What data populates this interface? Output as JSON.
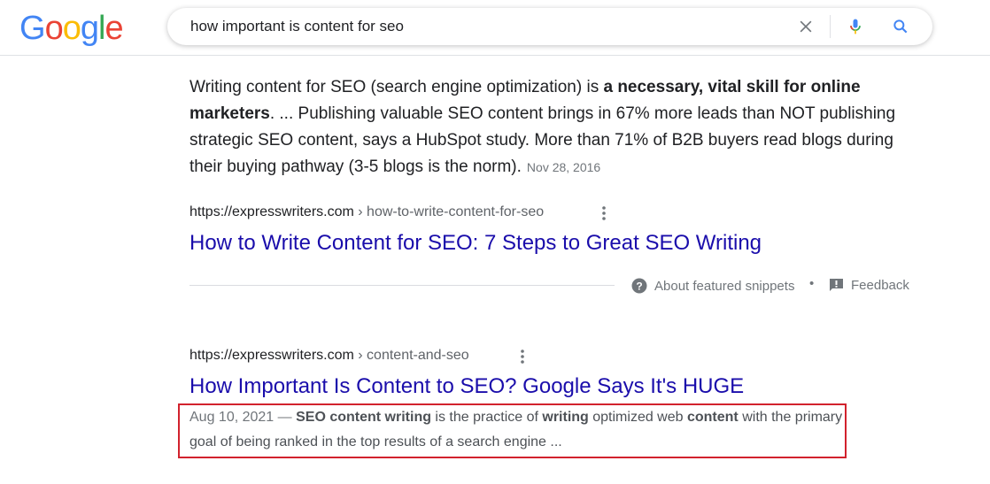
{
  "logo": {
    "letters": [
      "G",
      "o",
      "o",
      "g",
      "l",
      "e"
    ],
    "colors": [
      "#4285f4",
      "#ea4335",
      "#fbbc05",
      "#4285f4",
      "#34a853",
      "#ea4335"
    ]
  },
  "search": {
    "query": "how important is content for seo"
  },
  "featured_snippet": {
    "text_before": "Writing content for SEO (search engine optimization) is ",
    "bold": "a necessary, vital skill for online marketers",
    "text_after": ". ... Publishing valuable SEO content brings in 67% more leads than NOT publishing strategic SEO content, says a HubSpot study. More than 71% of B2B buyers read blogs during their buying pathway (3-5 blogs is the norm).",
    "date": "Nov 28, 2016",
    "url_domain": "https://expresswriters.com",
    "url_path": " › how-to-write-content-for-seo",
    "title": "How to Write Content for SEO: 7 Steps to Great SEO Writing",
    "about_label": "About featured snippets",
    "bullet": "•",
    "feedback_label": "Feedback"
  },
  "result": {
    "url_domain": "https://expresswriters.com",
    "url_path": " › content-and-seo",
    "title": "How Important Is Content to SEO? Google Says It's HUGE",
    "date": "Aug 10, 2021 —",
    "desc_parts": [
      {
        "t": " ",
        "b": false
      },
      {
        "t": "SEO content writing",
        "b": true
      },
      {
        "t": " is the practice of ",
        "b": false
      },
      {
        "t": "writing",
        "b": true
      },
      {
        "t": " optimized web ",
        "b": false
      },
      {
        "t": "content",
        "b": true
      },
      {
        "t": " with the primary goal of being ranked in the top results of a search engine ...",
        "b": false
      }
    ]
  },
  "colors": {
    "link": "#1a0dab",
    "highlight_border": "#d2222d"
  }
}
